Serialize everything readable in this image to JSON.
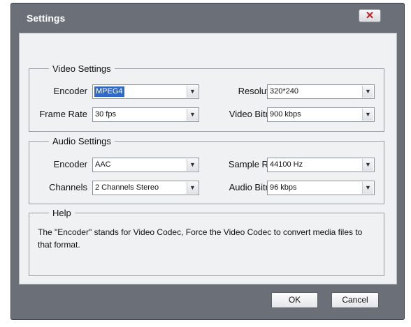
{
  "window": {
    "title": "Settings",
    "close_icon": "✕"
  },
  "video": {
    "legend": "Video Settings",
    "encoder": {
      "label": "Encoder",
      "value": "MPEG4"
    },
    "resolution": {
      "label": "Resolution",
      "value": "320*240"
    },
    "frame_rate": {
      "label": "Frame Rate",
      "value": "30 fps"
    },
    "video_bitrate": {
      "label": "Video Bitrate",
      "value": "900 kbps"
    }
  },
  "audio": {
    "legend": "Audio Settings",
    "encoder": {
      "label": "Encoder",
      "value": "AAC"
    },
    "sample_rate": {
      "label": "Sample Rate",
      "value": "44100 Hz"
    },
    "channels": {
      "label": "Channels",
      "value": "2 Channels Stereo"
    },
    "audio_bitrate": {
      "label": "Audio Bitrate",
      "value": "96 kbps"
    }
  },
  "help": {
    "legend": "Help",
    "text": "The \"Encoder\" stands for Video Codec, Force the Video Codec to convert media files to that format."
  },
  "buttons": {
    "ok": "OK",
    "cancel": "Cancel"
  },
  "icons": {
    "dropdown": "chevron-down-icon"
  }
}
